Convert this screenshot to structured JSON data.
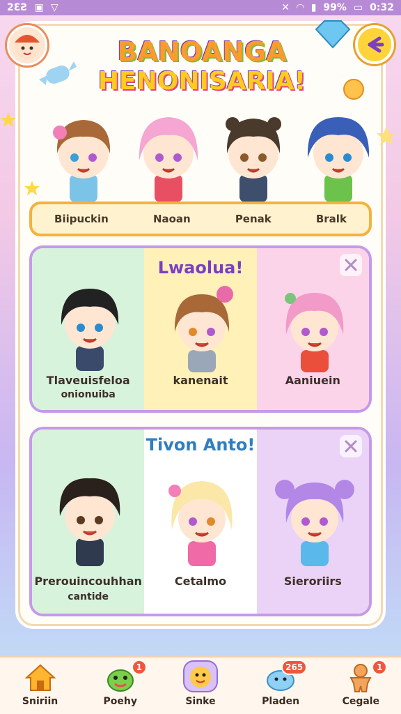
{
  "status_bar": {
    "time": "0:32",
    "battery": "99%",
    "left_text": "2ƐƧ"
  },
  "header": {
    "title_line1": "BANOANGA",
    "title_line2": "HENONISARIA!"
  },
  "top_characters": [
    "Biipuckin",
    "Naoan",
    "Penak",
    "Bralk"
  ],
  "panel1": {
    "title": "Lwaolua!",
    "characters": [
      {
        "name": "Tlaveuisfeloa",
        "sub": "onionuiba"
      },
      {
        "name": "kanenait",
        "sub": ""
      },
      {
        "name": "Aaniuein",
        "sub": ""
      }
    ]
  },
  "panel2": {
    "title": "Tivon Anto!",
    "characters": [
      {
        "name": "Prerouincouhhan",
        "sub": "cantide"
      },
      {
        "name": "Cetalmo",
        "sub": ""
      },
      {
        "name": "Sieroriirs",
        "sub": ""
      }
    ]
  },
  "nav": [
    {
      "label": "Sniriin",
      "icon": "home-icon",
      "badge": ""
    },
    {
      "label": "Poehy",
      "icon": "frog-icon",
      "badge": "1"
    },
    {
      "label": "Sinke",
      "icon": "face-icon",
      "badge": ""
    },
    {
      "label": "Pladen",
      "icon": "cloud-icon",
      "badge": "265"
    },
    {
      "label": "Cegale",
      "icon": "gingerbread-icon",
      "badge": "1"
    }
  ],
  "colors": {
    "accent": "#f4b23e",
    "panel_border": "#c59ae8",
    "badge": "#f0573a"
  }
}
